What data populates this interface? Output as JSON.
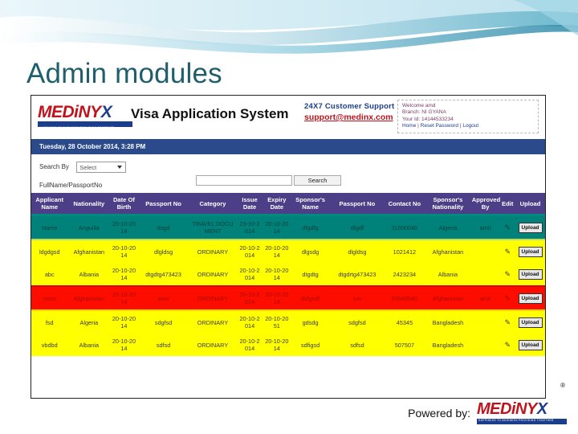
{
  "slide": {
    "title": "Admin modules",
    "footer_text": "Powered by:",
    "footer_logo_a": "M",
    "footer_logo_b": "EDiNY",
    "footer_logo_c": "X",
    "footer_tagline": "HAPPINESS TO BUSINESS PROVIDING TOGETHER",
    "registered_mark": "®"
  },
  "app": {
    "logo_a": "M",
    "logo_b": "EDiNY",
    "logo_c": "X",
    "logo_tagline": "HAPPINESS TO BUSINESS PROVIDING TOGETHER",
    "title": "Visa Application System",
    "support_line1": "24X7 Customer Support",
    "support_line2": "support@medinx.com",
    "welcome": {
      "line1": "Welcome amd",
      "line2": "Branch: NI GYANA",
      "line3": "Your Id: 14144533234",
      "link_home": "Home",
      "link_reset": "Reset Password",
      "link_logout": "Logout",
      "separator": "|"
    },
    "datebar": "Tuesday, 28 October 2014, 3:28 PM",
    "search": {
      "label": "Search By",
      "select_value": "Select",
      "sub_label": "FullName/PassportNo",
      "input_value": "",
      "input_placeholder": "",
      "button_label": "Search"
    }
  },
  "table": {
    "headers": [
      "Applicant Name",
      "Nationality",
      "Date Of Birth",
      "Passport No",
      "Category",
      "Issue Date",
      "Expiry Date",
      "Sponsor's Name",
      "Passport No",
      "Contact No",
      "Sponsor's Nationality",
      "Approved By",
      "Edit",
      "Upload"
    ],
    "edit_icon": "✎",
    "upload_label": "Upload",
    "rows": [
      {
        "style": "row-teal",
        "cells": [
          "Name",
          "Anguilla",
          "20-10-2014",
          "dsgd",
          "TRAVEL DOCUMENT",
          "23-10-2014",
          "20-10-2014",
          "dfgdfg",
          "dfgdf",
          "31500040",
          "Algeria",
          "amit"
        ]
      },
      {
        "style": "row-yellow",
        "cells": [
          "ldgdgsd",
          "Afghanistan",
          "20-10-2014",
          "dlgldsg",
          "ORDINARY",
          "20-10-2014",
          "20-10-2014",
          "dlgsdg",
          "dlgldsg",
          "1021412",
          "Afghanistan",
          ""
        ]
      },
      {
        "style": "row-yellow sep-red",
        "cells": [
          "abc",
          "Albania",
          "20-10-2014",
          "dtgdtg473423",
          "ORDINARY",
          "20-10-2014",
          "20-10-2014",
          "dtgdtg",
          "dtgdrtg473423",
          "2423234",
          "Albania",
          ""
        ]
      },
      {
        "style": "row-red",
        "cells": [
          "nono",
          "Afghanistan",
          "20-10-2014",
          "axxv",
          "ORDINARY",
          "20-10-2014",
          "20-10-2014",
          "dsfgsdf",
          "xxv",
          "83048540",
          "Afghanistan",
          "amit"
        ]
      },
      {
        "style": "row-yellow",
        "cells": [
          "fsd",
          "Algeria",
          "20-10-2014",
          "sdgfsd",
          "ORDINARY",
          "20-10-2014",
          "20-10-2051",
          "gdsdg",
          "sdgfsd",
          "45345",
          "Bangladesh",
          ""
        ]
      },
      {
        "style": "row-yellow",
        "cells": [
          "vbdbd",
          "Albania",
          "20-10-2014",
          "sdfsd",
          "ORDINARY",
          "20-10-2014",
          "20-10-2014",
          "sdfigsd",
          "sdfsd",
          "507507",
          "Bangladesh",
          ""
        ]
      }
    ]
  }
}
